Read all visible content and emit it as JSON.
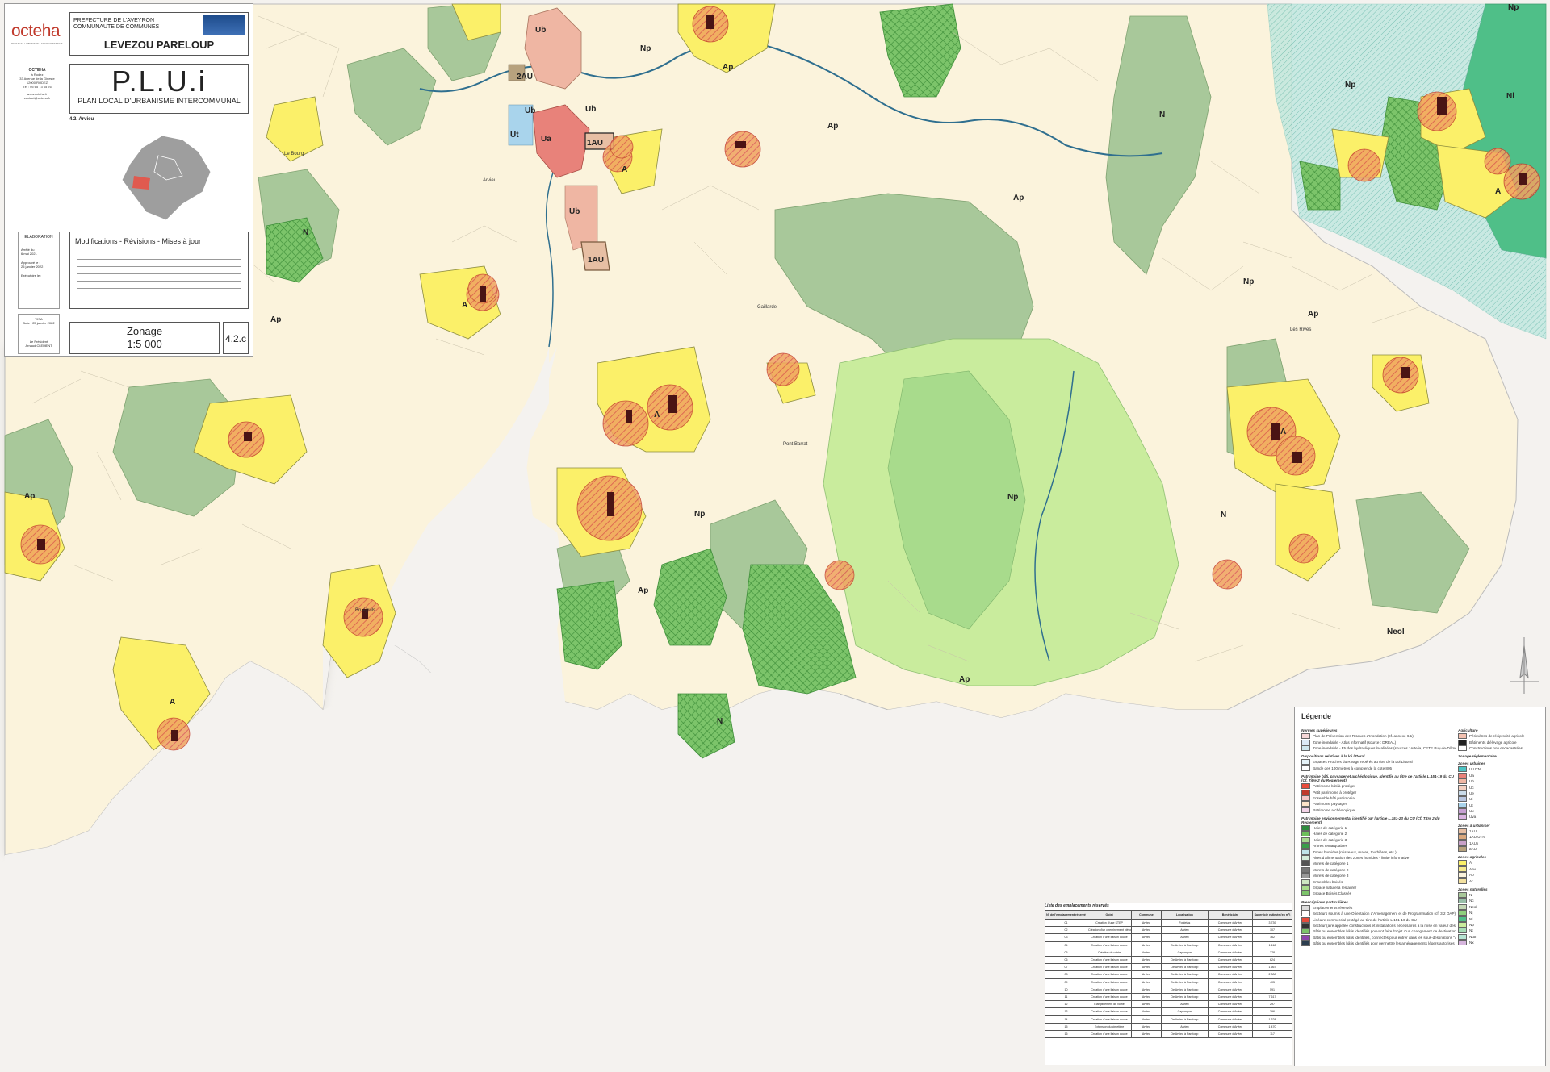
{
  "cartouche": {
    "brand": "octeha",
    "brand_sub": "PAYSAGE - URBANISME - ENVIRONNEMENT",
    "firm": {
      "name": "OCTEHA",
      "lines": [
        "à Rodez",
        "33 Avenue de la Gineste",
        "12000 RODEZ",
        "Tél : 05 65 73 65 76",
        "www.octeha.fr",
        "contact@octeha.fr"
      ]
    },
    "header_lines": [
      "PREFECTURE DE L'AVEYRON",
      "COMMUNAUTE DE COMMUNES"
    ],
    "community": "LEVEZOU PARELOUP",
    "plan_title": "P.L.U.i",
    "plan_subtitle": "PLAN LOCAL D'URBANISME INTERCOMMUNAL",
    "sector": "4.2. Arvieu",
    "elaboration": {
      "title": "ELABORATION",
      "lines": [
        "Arrêté du :",
        "6 mai 2021",
        "Approuvé le :",
        "25 janvier 2022",
        "Exécutoire le :"
      ]
    },
    "visa": {
      "title": "VISA",
      "lines": [
        "Date : 25 janvier 2022",
        "Le Président",
        "Arnaud CLEMENT"
      ]
    },
    "modifications_title": "Modifications - Révisions - Mises à jour",
    "zonage_title": "Zonage",
    "scale": "1:5 000",
    "plan_number": "4.2.c"
  },
  "map": {
    "zone_labels": [
      {
        "text": "Ub"
      },
      {
        "text": "2AU"
      },
      {
        "text": "Ub"
      },
      {
        "text": "Ub"
      },
      {
        "text": "Ua"
      },
      {
        "text": "1AU"
      },
      {
        "text": "Ub"
      },
      {
        "text": "Ut"
      },
      {
        "text": "1AU"
      },
      {
        "text": "Np"
      },
      {
        "text": "Np"
      },
      {
        "text": "Np"
      },
      {
        "text": "N"
      },
      {
        "text": "N"
      },
      {
        "text": "N"
      },
      {
        "text": "N"
      },
      {
        "text": "Nl"
      },
      {
        "text": "Ap"
      },
      {
        "text": "Ap"
      },
      {
        "text": "Ap"
      },
      {
        "text": "Ap"
      },
      {
        "text": "Ap"
      },
      {
        "text": "Ap"
      },
      {
        "text": "Ap"
      },
      {
        "text": "Ap"
      },
      {
        "text": "A"
      },
      {
        "text": "A"
      },
      {
        "text": "A"
      },
      {
        "text": "A"
      },
      {
        "text": "A"
      },
      {
        "text": "A"
      },
      {
        "text": "Np"
      },
      {
        "text": "Np"
      },
      {
        "text": "Neol"
      },
      {
        "text": "Np"
      }
    ],
    "place_labels": [
      "Le Bourg",
      "Arvieu",
      "Gaillarde",
      "Pont Barrat",
      "Les Rives",
      "Bruéjouls"
    ]
  },
  "legend": {
    "title": "Légende",
    "col1": [
      {
        "section": "Normes supérieures",
        "items": [
          {
            "label": "Plan de Prévention des Risques d'Inondation (cf. annexe 6.1)",
            "color": "#f6d8d8"
          },
          {
            "label": "Zone inondable - Atlas informatif (source : DREAL)",
            "color": "#dbe9f5"
          },
          {
            "label": "Zone inondable - Etudes hydrauliques localisées (sources : Artelia, CETE Puy-de-Dôme)",
            "color": "#cfe7ee"
          }
        ]
      },
      {
        "section": "Dispositions relatives à la loi littoral",
        "items": [
          {
            "label": "Espaces Proches du Rivage repérés au titre de la Loi Littoral",
            "color": "#e6f3f8"
          },
          {
            "label": "Bande des 100 mètres à compter de la cote 805",
            "color": "#ffffff"
          }
        ]
      },
      {
        "section": "Patrimoine bâti, paysager et archéologique, identifié au titre de l'article L.151-19 du CU (Cf. Titre 2 du Règlement)",
        "items": [
          {
            "label": "Patrimoine bâti à protéger",
            "color": "#e74c3c"
          },
          {
            "label": "Petit patrimoine à protéger",
            "color": "#c0392b"
          },
          {
            "label": "Ensemble bâti patrimonial",
            "color": "#f5c6c6"
          },
          {
            "label": "Patrimoine paysager",
            "color": "#fde4c8"
          },
          {
            "label": "Patrimoine archéologique",
            "color": "#f3d3e7"
          }
        ]
      },
      {
        "section": "Patrimoine environnemental identifié par l'article L.151-23 du CU (Cf. Titre 2 du Règlement)",
        "items": [
          {
            "label": "Haies de catégorie 1",
            "color": "#2e8b3e"
          },
          {
            "label": "Haies de catégorie 2",
            "color": "#6cbf5a"
          },
          {
            "label": "Haies de catégorie 3",
            "color": "#a6d88f"
          },
          {
            "label": "Arbres remarquables",
            "color": "#3a9d4a"
          },
          {
            "label": "Zones humides (ruisseaux, mares, tourbières, etc.)",
            "color": "#bfe3e8"
          },
          {
            "label": "Aires d'alimentation des zones humides - limite informative",
            "color": "#d4ecd9"
          },
          {
            "label": "Murets de catégorie 1",
            "color": "#555555"
          },
          {
            "label": "Murets de catégorie 2",
            "color": "#777777"
          },
          {
            "label": "Murets de catégorie 3",
            "color": "#999999"
          },
          {
            "label": "Ensembles boisés",
            "color": "#cde6c2"
          },
          {
            "label": "Espace naturel à restaurer",
            "color": "#a8db8c"
          },
          {
            "label": "Espace Boisés Classés",
            "color": "#7cc46a"
          }
        ]
      },
      {
        "section": "Prescriptions particulières",
        "items": [
          {
            "label": "Emplacements réservés",
            "color": "#dddddd"
          },
          {
            "label": "Secteurs soumis à une Orientation d'Aménagement et de Programmation (cf. 3.2 OAP)",
            "color": "#ffffff"
          },
          {
            "label": "Linéaire commercial protégé au titre de l'article L.151-16 du CU",
            "color": "#e74c3c"
          },
          {
            "label": "Secteur (aire appelée constructions et installations nécessaires à la mise en valeur des ressources naturelles sont autorisées)",
            "color": "#333333"
          },
          {
            "label": "Bâtis ou ensembles bâtis identifiés pouvant faire l'objet d'un changement de destination",
            "color": "#7cc46a"
          },
          {
            "label": "Bâtis ou ensembles bâtis identifiés, connectés pour entrer dans les sous-destinations \"Artisanat et commerce de détail\"",
            "color": "#8e44ad"
          },
          {
            "label": "Bâtis ou ensembles bâtis identifiés pour permettre les aménagements légers autorisés en secteur Np",
            "color": "#2c3e50"
          }
        ]
      }
    ],
    "col2": [
      {
        "section": "Agriculture",
        "items": [
          {
            "label": "Périmètres de réciprocité agricole",
            "color": "#f3c1b0"
          },
          {
            "label": "Bâtiments d'élevage agricole",
            "color": "#222222"
          },
          {
            "label": "Constructions non encadastrées",
            "color": "#ffffff"
          }
        ]
      },
      {
        "section": "Zonage réglementaire",
        "items": []
      },
      {
        "section": "Zones urbaines",
        "items": [
          {
            "label": "U UTN",
            "color": "#4cc4c4"
          },
          {
            "label": "Ua",
            "color": "#e8827a"
          },
          {
            "label": "Ub",
            "color": "#efb6a3"
          },
          {
            "label": "Uc",
            "color": "#f3d0c1"
          },
          {
            "label": "Ue",
            "color": "#c9dbe9"
          },
          {
            "label": "Ui",
            "color": "#b8c6e0"
          },
          {
            "label": "Ut",
            "color": "#a9d4ec"
          },
          {
            "label": "Ux",
            "color": "#c6a0d2"
          },
          {
            "label": "Uva",
            "color": "#d9b3e0"
          }
        ]
      },
      {
        "section": "Zones à urbaniser",
        "items": [
          {
            "label": "1AU",
            "color": "#e7bfa4"
          },
          {
            "label": "1AU UTN",
            "color": "#d9a87e"
          },
          {
            "label": "1AUx",
            "color": "#c8a1c9"
          },
          {
            "label": "2AU",
            "color": "#b7a27e"
          }
        ]
      },
      {
        "section": "Zones agricoles",
        "items": [
          {
            "label": "A",
            "color": "#fbf069"
          },
          {
            "label": "Aev",
            "color": "#f6ea8e"
          },
          {
            "label": "Ap",
            "color": "#fbf3dc"
          },
          {
            "label": "Ar",
            "color": "#f3e1a0"
          }
        ]
      },
      {
        "section": "Zones naturelles",
        "items": [
          {
            "label": "N",
            "color": "#a8c89a"
          },
          {
            "label": "Nc",
            "color": "#98bfa8"
          },
          {
            "label": "Neol",
            "color": "#c4d8b6"
          },
          {
            "label": "Nj",
            "color": "#8fd07d"
          },
          {
            "label": "Nl",
            "color": "#4fbf88"
          },
          {
            "label": "Np",
            "color": "#c9ec9d"
          },
          {
            "label": "Nt",
            "color": "#a6ddb6"
          },
          {
            "label": "Nutn",
            "color": "#b7e5d3"
          },
          {
            "label": "Nx",
            "color": "#d6b5dd"
          }
        ]
      }
    ]
  },
  "reserved": {
    "caption": "Liste des emplacements réservés",
    "headers": [
      "N° de l'emplacement réservé",
      "Objet",
      "Commune",
      "Localisation",
      "Bénéficiaire",
      "Superficie estimée (en m²)"
    ],
    "rows": [
      [
        "01",
        "Création d'une STEP",
        "Arvieu",
        "Fouletas",
        "Commune d'Arvieu",
        "3 739"
      ],
      [
        "02",
        "Création d'un cheminement piéton",
        "Arvieu",
        "Arvieu",
        "Commune d'Arvieu",
        "107"
      ],
      [
        "03",
        "Création d'une liaison douce",
        "Arvieu",
        "Arvieu",
        "Commune d'Arvieu",
        "162"
      ],
      [
        "04",
        "Création d'une liaison douce",
        "Arvieu",
        "De Arvieu à Pareloup",
        "Commune d'Arvieu",
        "1 118"
      ],
      [
        "05",
        "Création de voirie",
        "Arvieu",
        "Caplongue",
        "Commune d'Arvieu",
        "278"
      ],
      [
        "06",
        "Création d'une liaison douce",
        "Arvieu",
        "De Arvieu à Pareloup",
        "Commune d'Arvieu",
        "624"
      ],
      [
        "07",
        "Création d'une liaison douce",
        "Arvieu",
        "De Arvieu à Pareloup",
        "Commune d'Arvieu",
        "1 667"
      ],
      [
        "08",
        "Création d'une liaison douce",
        "Arvieu",
        "De Arvieu à Pareloup",
        "Commune d'Arvieu",
        "2 308"
      ],
      [
        "09",
        "Création d'une liaison douce",
        "Arvieu",
        "De Arvieu à Pareloup",
        "Commune d'Arvieu",
        "405"
      ],
      [
        "10",
        "Création d'une liaison douce",
        "Arvieu",
        "De Arvieu à Pareloup",
        "Commune d'Arvieu",
        "591"
      ],
      [
        "11",
        "Création d'une liaison douce",
        "Arvieu",
        "De Arvieu à Pareloup",
        "Commune d'Arvieu",
        "7 617"
      ],
      [
        "12",
        "Elargissement de voirie",
        "Arvieu",
        "Arvieu",
        "Commune d'Arvieu",
        "297"
      ],
      [
        "13",
        "Création d'une liaison douce",
        "Arvieu",
        "Caplongue",
        "Commune d'Arvieu",
        "396"
      ],
      [
        "14",
        "Création d'une liaison douce",
        "Arvieu",
        "De Arvieu à Pareloup",
        "Commune d'Arvieu",
        "1 328"
      ],
      [
        "15",
        "Extension du cimetière",
        "Arvieu",
        "Arvieu",
        "Commune d'Arvieu",
        "1 470"
      ],
      [
        "16",
        "Création d'une liaison douce",
        "Arvieu",
        "De Arvieu à Pareloup",
        "Commune d'Arvieu",
        "117"
      ]
    ]
  }
}
